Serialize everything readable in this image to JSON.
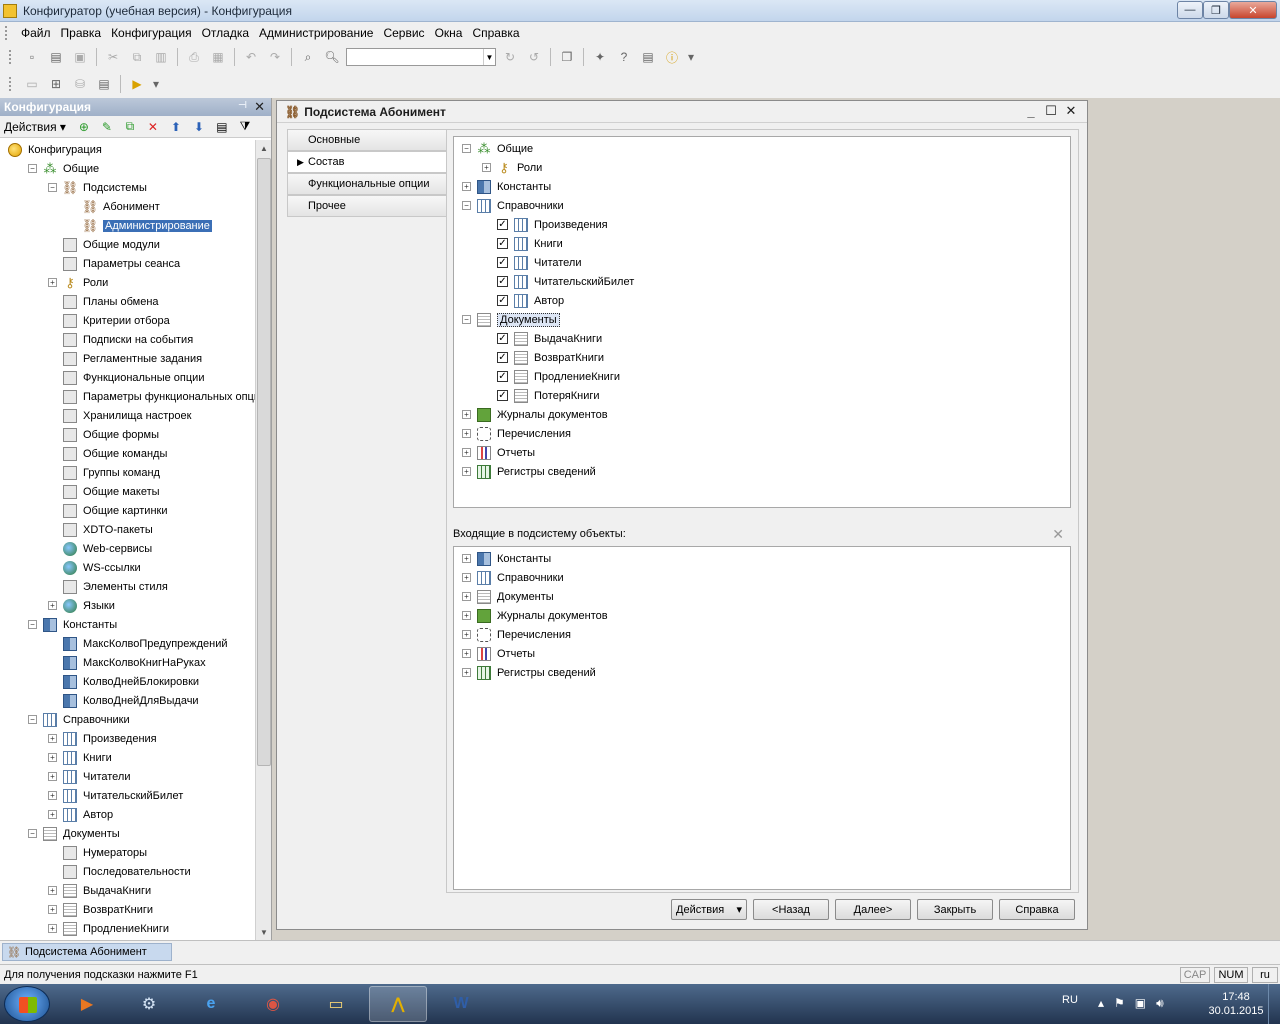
{
  "window": {
    "title": "Конфигуратор (учебная версия) - Конфигурация"
  },
  "menu": [
    "Файл",
    "Правка",
    "Конфигурация",
    "Отладка",
    "Администрирование",
    "Сервис",
    "Окна",
    "Справка"
  ],
  "left_pane": {
    "title": "Конфигурация",
    "actions_label": "Действия",
    "tree": [
      {
        "label": "Конфигурация",
        "level": 0,
        "icon": "config",
        "exp": "none"
      },
      {
        "label": "Общие",
        "level": 1,
        "icon": "common",
        "exp": "minus"
      },
      {
        "label": "Подсистемы",
        "level": 2,
        "icon": "sub",
        "exp": "minus"
      },
      {
        "label": "Абонимент",
        "level": 3,
        "icon": "sub",
        "exp": "none"
      },
      {
        "label": "Администрирование",
        "level": 3,
        "icon": "sub",
        "exp": "none",
        "selected": true
      },
      {
        "label": "Общие модули",
        "level": 2,
        "icon": "generic",
        "exp": "none"
      },
      {
        "label": "Параметры сеанса",
        "level": 2,
        "icon": "generic",
        "exp": "none"
      },
      {
        "label": "Роли",
        "level": 2,
        "icon": "role",
        "exp": "plus"
      },
      {
        "label": "Планы обмена",
        "level": 2,
        "icon": "generic",
        "exp": "none"
      },
      {
        "label": "Критерии отбора",
        "level": 2,
        "icon": "generic",
        "exp": "none"
      },
      {
        "label": "Подписки на события",
        "level": 2,
        "icon": "generic",
        "exp": "none"
      },
      {
        "label": "Регламентные задания",
        "level": 2,
        "icon": "generic",
        "exp": "none"
      },
      {
        "label": "Функциональные опции",
        "level": 2,
        "icon": "generic",
        "exp": "none"
      },
      {
        "label": "Параметры функциональных опций",
        "level": 2,
        "icon": "generic",
        "exp": "none"
      },
      {
        "label": "Хранилища настроек",
        "level": 2,
        "icon": "generic",
        "exp": "none"
      },
      {
        "label": "Общие формы",
        "level": 2,
        "icon": "generic",
        "exp": "none"
      },
      {
        "label": "Общие команды",
        "level": 2,
        "icon": "generic",
        "exp": "none"
      },
      {
        "label": "Группы команд",
        "level": 2,
        "icon": "generic",
        "exp": "none"
      },
      {
        "label": "Общие макеты",
        "level": 2,
        "icon": "generic",
        "exp": "none"
      },
      {
        "label": "Общие картинки",
        "level": 2,
        "icon": "generic",
        "exp": "none"
      },
      {
        "label": "XDTO-пакеты",
        "level": 2,
        "icon": "generic",
        "exp": "none"
      },
      {
        "label": "Web-сервисы",
        "level": 2,
        "icon": "globe",
        "exp": "none"
      },
      {
        "label": "WS-ссылки",
        "level": 2,
        "icon": "globe",
        "exp": "none"
      },
      {
        "label": "Элементы стиля",
        "level": 2,
        "icon": "generic",
        "exp": "none"
      },
      {
        "label": "Языки",
        "level": 2,
        "icon": "globe",
        "exp": "plus"
      },
      {
        "label": "Константы",
        "level": 1,
        "icon": "const",
        "exp": "minus"
      },
      {
        "label": "МаксКолвоПредупреждений",
        "level": 2,
        "icon": "const",
        "exp": "none"
      },
      {
        "label": "МаксКолвоКнигНаРуках",
        "level": 2,
        "icon": "const",
        "exp": "none"
      },
      {
        "label": "КолвоДнейБлокировки",
        "level": 2,
        "icon": "const",
        "exp": "none"
      },
      {
        "label": "КолвоДнейДляВыдачи",
        "level": 2,
        "icon": "const",
        "exp": "none"
      },
      {
        "label": "Справочники",
        "level": 1,
        "icon": "grid",
        "exp": "minus"
      },
      {
        "label": "Произведения",
        "level": 2,
        "icon": "grid",
        "exp": "plus"
      },
      {
        "label": "Книги",
        "level": 2,
        "icon": "grid",
        "exp": "plus"
      },
      {
        "label": "Читатели",
        "level": 2,
        "icon": "grid",
        "exp": "plus"
      },
      {
        "label": "ЧитательскийБилет",
        "level": 2,
        "icon": "grid",
        "exp": "plus"
      },
      {
        "label": "Автор",
        "level": 2,
        "icon": "grid",
        "exp": "plus"
      },
      {
        "label": "Документы",
        "level": 1,
        "icon": "doc",
        "exp": "minus"
      },
      {
        "label": "Нумераторы",
        "level": 2,
        "icon": "generic",
        "exp": "none"
      },
      {
        "label": "Последовательности",
        "level": 2,
        "icon": "generic",
        "exp": "none"
      },
      {
        "label": "ВыдачаКниги",
        "level": 2,
        "icon": "doc",
        "exp": "plus"
      },
      {
        "label": "ВозвратКниги",
        "level": 2,
        "icon": "doc",
        "exp": "plus"
      },
      {
        "label": "ПродлениеКниги",
        "level": 2,
        "icon": "doc",
        "exp": "plus"
      }
    ]
  },
  "subsystem_window": {
    "title": "Подсистема Абонимент",
    "tabs": [
      "Основные",
      "Состав",
      "Функциональные опции",
      "Прочее"
    ],
    "active_tab": 1,
    "composition": [
      {
        "label": "Общие",
        "level": 0,
        "icon": "common",
        "exp": "minus"
      },
      {
        "label": "Роли",
        "level": 1,
        "icon": "role",
        "exp": "plus"
      },
      {
        "label": "Константы",
        "level": 0,
        "icon": "const",
        "exp": "plus"
      },
      {
        "label": "Справочники",
        "level": 0,
        "icon": "grid",
        "exp": "minus"
      },
      {
        "label": "Произведения",
        "level": 1,
        "icon": "grid",
        "checked": true
      },
      {
        "label": "Книги",
        "level": 1,
        "icon": "grid",
        "checked": true
      },
      {
        "label": "Читатели",
        "level": 1,
        "icon": "grid",
        "checked": true
      },
      {
        "label": "ЧитательскийБилет",
        "level": 1,
        "icon": "grid",
        "checked": true
      },
      {
        "label": "Автор",
        "level": 1,
        "icon": "grid",
        "checked": true
      },
      {
        "label": "Документы",
        "level": 0,
        "icon": "doc",
        "exp": "minus",
        "focused": true
      },
      {
        "label": "ВыдачаКниги",
        "level": 1,
        "icon": "doc",
        "checked": true
      },
      {
        "label": "ВозвратКниги",
        "level": 1,
        "icon": "doc",
        "checked": true
      },
      {
        "label": "ПродлениеКниги",
        "level": 1,
        "icon": "doc",
        "checked": true
      },
      {
        "label": "ПотеряКниги",
        "level": 1,
        "icon": "doc",
        "checked": true
      },
      {
        "label": "Журналы документов",
        "level": 0,
        "icon": "green",
        "exp": "plus"
      },
      {
        "label": "Перечисления",
        "level": 0,
        "icon": "enum",
        "exp": "plus"
      },
      {
        "label": "Отчеты",
        "level": 0,
        "icon": "report",
        "exp": "plus"
      },
      {
        "label": "Регистры сведений",
        "level": 0,
        "icon": "reg",
        "exp": "plus"
      }
    ],
    "incoming_label": "Входящие в подсистему объекты:",
    "incoming": [
      {
        "label": "Константы",
        "icon": "const"
      },
      {
        "label": "Справочники",
        "icon": "grid"
      },
      {
        "label": "Документы",
        "icon": "doc"
      },
      {
        "label": "Журналы документов",
        "icon": "green"
      },
      {
        "label": "Перечисления",
        "icon": "enum"
      },
      {
        "label": "Отчеты",
        "icon": "report"
      },
      {
        "label": "Регистры сведений",
        "icon": "reg"
      }
    ],
    "buttons": {
      "actions": "Действия",
      "back": "<Назад",
      "next": "Далее>",
      "close": "Закрыть",
      "help": "Справка"
    }
  },
  "window_tab": "Подсистема Абонимент",
  "status": {
    "hint": "Для получения подсказки нажмите F1",
    "cap": "CAP",
    "num": "NUM",
    "lang": "ru"
  },
  "tray": {
    "lang": "RU",
    "time": "17:48",
    "date": "30.01.2015"
  }
}
